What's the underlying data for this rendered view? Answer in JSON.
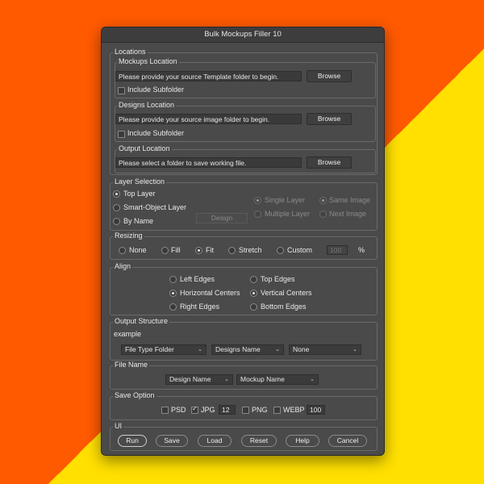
{
  "window": {
    "title": "Bulk Mockups Filler 10"
  },
  "locations": {
    "label": "Locations",
    "mockups": {
      "label": "Mockups Location",
      "path": "Please provide your source Template folder to begin.",
      "browse": "Browse",
      "include_subfolder": "Include Subfolder"
    },
    "designs": {
      "label": "Designs Location",
      "path": "Please provide your source image folder to begin.",
      "browse": "Browse",
      "include_subfolder": "Include Subfolder"
    },
    "output": {
      "label": "Output Location",
      "path": "Please select a folder to save working file.",
      "browse": "Browse"
    }
  },
  "layer_selection": {
    "label": "Layer Selection",
    "options": [
      "Top Layer",
      "Smart-Object Layer",
      "By Name"
    ],
    "selected": "Top Layer",
    "design_button": "Design",
    "sub_options": {
      "single_layer": "Single Layer",
      "multiple_layer": "Multiple Layer",
      "same_image": "Same Image",
      "next_image": "Next Image"
    }
  },
  "resizing": {
    "label": "Resizing",
    "options": [
      "None",
      "Fill",
      "Fit",
      "Stretch",
      "Custom"
    ],
    "selected": "Fit",
    "custom_value": "100",
    "unit": "%"
  },
  "align": {
    "label": "Align",
    "left": [
      "Left Edges",
      "Horizontal Centers",
      "Right Edges"
    ],
    "right": [
      "Top Edges",
      "Vertical Centers",
      "Bottom Edges"
    ],
    "selected_h": "Horizontal Centers",
    "selected_v": "Vertical Centers"
  },
  "output_structure": {
    "label": "Output Structure",
    "example": "example",
    "selects": [
      "File Type Folder",
      "Designs Name",
      "None"
    ]
  },
  "file_name": {
    "label": "File Name",
    "selects": [
      "Design Name",
      "Mockup Name"
    ]
  },
  "save_option": {
    "label": "Save Option",
    "psd": "PSD",
    "jpg": "JPG",
    "jpg_quality": "12",
    "png": "PNG",
    "webp": "WEBP",
    "webp_quality": "100"
  },
  "ui": {
    "label": "UI",
    "buttons": [
      "Run",
      "Save",
      "Load",
      "Reset",
      "Help",
      "Cancel"
    ]
  },
  "colors": {
    "orange": "#ff5a00",
    "yellow": "#ffe000",
    "panel": "#4a4a4a"
  }
}
